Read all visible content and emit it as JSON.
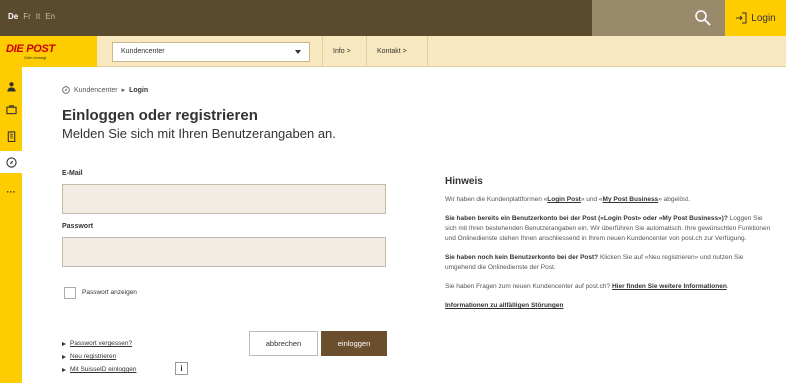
{
  "topbar": {
    "languages": [
      "De",
      "Fr",
      "It",
      "En"
    ],
    "active_language": "De",
    "login_label": "Login",
    "search_icon": "search-icon",
    "login_icon": "login-arrow-icon"
  },
  "header": {
    "logo_text": "DIE POST",
    "logo_tagline": "Gelb bewegt",
    "select_value": "Kundencenter",
    "nav": [
      {
        "label": "Info >"
      },
      {
        "label": "Kontakt >"
      }
    ]
  },
  "sidebar": {
    "items": [
      {
        "icon": "person-icon"
      },
      {
        "icon": "briefcase-icon"
      },
      {
        "icon": "building-icon"
      },
      {
        "icon": "compass-icon"
      },
      {
        "icon": "more-icon",
        "label": "···"
      }
    ]
  },
  "breadcrumb": {
    "root": "Kundencenter",
    "separator": "▸",
    "current": "Login"
  },
  "main": {
    "title": "Einloggen oder registrieren",
    "subtitle": "Melden Sie sich mit Ihren Benutzerangaben an.",
    "email_label": "E-Mail",
    "email_value": "",
    "password_label": "Passwort",
    "password_value": "",
    "show_password_label": "Passwort anzeigen",
    "links": [
      {
        "label": "Passwort vergessen?"
      },
      {
        "label": "Neu registrieren"
      },
      {
        "label": "Mit SuisseID einloggen"
      }
    ],
    "info_label": "i",
    "cancel_label": "abbrechen",
    "login_label": "einloggen"
  },
  "hint": {
    "title": "Hinweis",
    "p1_pre": "Wir haben die Kundenplattformen «",
    "p1_link1": "Login Post",
    "p1_mid": "» und «",
    "p1_link2": "My Post Business",
    "p1_post": "» abgelöst.",
    "p2_bold": "Sie haben bereits ein Benutzerkonto bei der Post («Login Post» oder «My Post Business»)?",
    "p2_text": " Loggen Sie sich mit Ihren bestehenden Benutzerangaben ein. Wir überführen Sie automatisch. Ihre gewünschten Funktionen und Onlinedienste stehen Ihnen anschliessend in Ihrem neuen Kundencenter von post.ch zur Verfügung.",
    "p3_bold": "Sie haben noch kein Benutzerkonto bei der Post?",
    "p3_text": " Klicken Sie auf «Neu registrieren» und nutzen Sie umgehend die Onlinedienste der Post.",
    "p4_text": "Sie haben Fragen zum neuen Kundencenter auf post.ch? ",
    "p4_link": "Hier finden Sie weitere Informationen",
    "p4_end": ".",
    "p5_link": "Informationen zu allfälligen Störungen"
  },
  "colors": {
    "brand_yellow": "#ffcc00",
    "topbar_brown": "#5a4a2e",
    "button_brown": "#6b4e2e"
  }
}
